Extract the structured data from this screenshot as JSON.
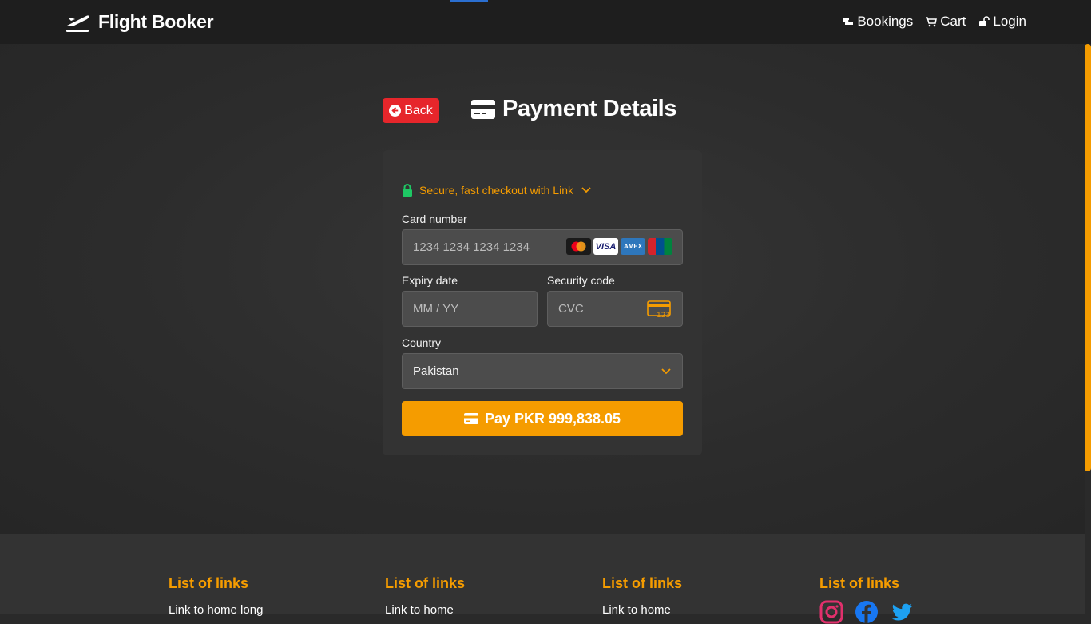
{
  "header": {
    "brand": "Flight Booker",
    "nav": [
      {
        "label": "Bookings",
        "icon": "ticket-icon"
      },
      {
        "label": "Cart",
        "icon": "cart-icon"
      },
      {
        "label": "Login",
        "icon": "unlock-icon"
      }
    ]
  },
  "page": {
    "back_label": "Back",
    "title": "Payment Details"
  },
  "form": {
    "link_text": "Secure, fast checkout with Link",
    "card_number_label": "Card number",
    "card_number_placeholder": "1234 1234 1234 1234",
    "expiry_label": "Expiry date",
    "expiry_placeholder": "MM / YY",
    "security_label": "Security code",
    "security_placeholder": "CVC",
    "cvc_icon_text": "123",
    "country_label": "Country",
    "country_value": "Pakistan",
    "card_brands": [
      "mastercard",
      "VISA",
      "AMEX",
      "unionpay"
    ],
    "pay_label": "Pay PKR 999,838.05"
  },
  "footer": {
    "columns": [
      {
        "title": "List of links",
        "link": "Link to home long"
      },
      {
        "title": "List of links",
        "link": "Link to home"
      },
      {
        "title": "List of links",
        "link": "Link to home"
      },
      {
        "title": "List of links",
        "socials": [
          "instagram-icon",
          "facebook-icon",
          "twitter-icon"
        ]
      }
    ]
  },
  "colors": {
    "accent": "#f59c00",
    "back_button": "#e6262b",
    "lock": "#1ec864",
    "header_bg": "#1e1e1e"
  }
}
